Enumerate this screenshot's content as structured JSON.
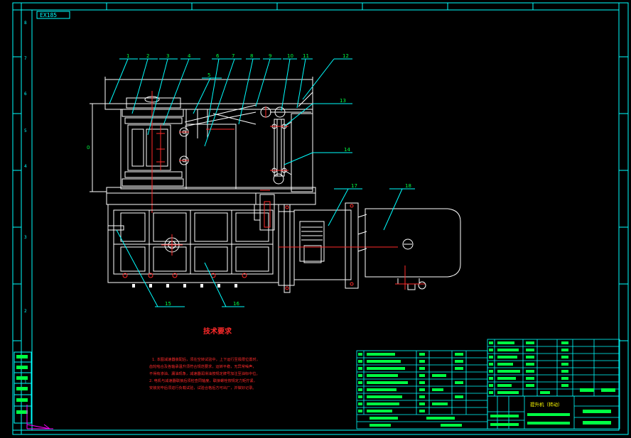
{
  "drawing": {
    "drawing_number": "EX185",
    "section_title": "技术要求",
    "requirements": [
      "1. 本图减速器装配后，须在空转试验中，上下运行至极限位置时，",
      "齿轮啮合及各轴承温升须符合规范要求，运转平稳，无异常噪声，",
      "不得有渗油、漏油现象，减速器润滑油按规定牌号加注至油标中位。",
      "2. 电机与减速器联接后须检查同轴度，联接螺栓按规定力矩拧紧，",
      "安装完毕后须进行负载试验，试验合格后方可出厂，并做好记录。"
    ],
    "title_block_name": "提升机（转动）"
  },
  "frame": {
    "left_zone_marks": [
      "8",
      "7",
      "6",
      "5",
      "4",
      "3",
      "2",
      "1"
    ]
  },
  "balloons": {
    "top_row": [
      "1",
      "2",
      "3",
      "4",
      "5",
      "6",
      "7",
      "8",
      "9",
      "10",
      "11",
      "12"
    ],
    "right": [
      "13",
      "14"
    ],
    "bottom": [
      "15",
      "16"
    ],
    "motor": [
      "17",
      "18"
    ],
    "dim_height": "0"
  },
  "colors": {
    "frame": "#00ffff",
    "outline": "#ffffff",
    "leader": "#00ffff",
    "center": "#ff2a2a",
    "text": "#ff2a2a",
    "table_fill": "#00ff44",
    "accent": "#ffff00"
  }
}
